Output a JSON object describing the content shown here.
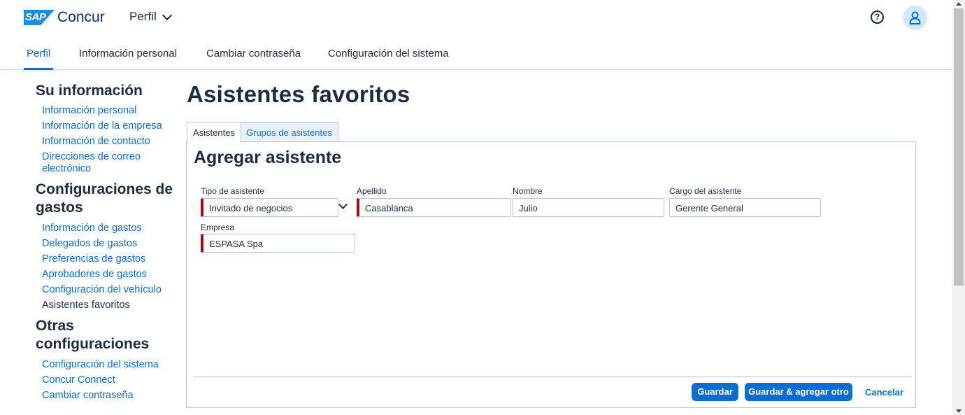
{
  "header": {
    "logo_sap": "SAP",
    "logo_brand": "Concur",
    "menu_label": "Perfil",
    "help_icon": "question-circle-icon",
    "user_icon": "user-avatar-icon"
  },
  "nav": {
    "tabs": [
      {
        "label": "Perfil",
        "active": true
      },
      {
        "label": "Información personal"
      },
      {
        "label": "Cambiar contraseña"
      },
      {
        "label": "Configuración del sistema"
      }
    ]
  },
  "sidebar": {
    "sections": [
      {
        "heading": "Su información",
        "links": [
          "Información personal",
          "Información de la empresa",
          "Información de contacto",
          "Direcciones de correo electrónico"
        ]
      },
      {
        "heading": "Configuraciones de gastos",
        "links": [
          "Información de gastos",
          "Delegados de gastos",
          "Preferencias de gastos",
          "Aprobadores de gastos",
          "Configuración del vehículo",
          "Asistentes favoritos"
        ]
      },
      {
        "heading": "Otras configuraciones",
        "links": [
          "Configuración del sistema",
          "Concur Connect",
          "Cambiar contraseña"
        ]
      }
    ]
  },
  "main": {
    "title": "Asistentes favoritos",
    "tabs": [
      {
        "label": "Asistentes",
        "active": true
      },
      {
        "label": "Grupos de asistentes"
      }
    ],
    "form": {
      "title": "Agregar asistente",
      "fields": {
        "tipo": {
          "label": "Tipo de asistente",
          "value": "Invitado de negocios"
        },
        "apellido": {
          "label": "Apellido",
          "value": "Casablanca"
        },
        "nombre": {
          "label": "Nombre",
          "value": "Julio"
        },
        "cargo": {
          "label": "Cargo del asistente",
          "value": "Gerente General"
        },
        "empresa": {
          "label": "Empresa",
          "value": "ESPASA Spa"
        }
      },
      "buttons": {
        "save": "Guardar",
        "save_add": "Guardar & agregar otro",
        "cancel": "Cancelar"
      }
    }
  },
  "colors": {
    "accent": "#0a6ed1",
    "required": "#a20e0e",
    "text": "#1d2d3e"
  }
}
